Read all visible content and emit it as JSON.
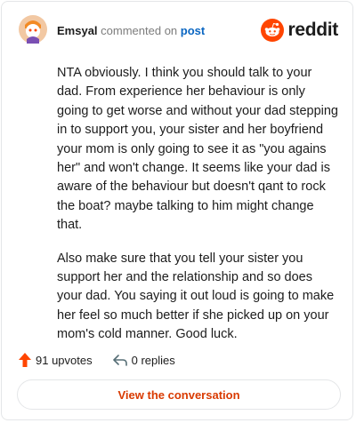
{
  "header": {
    "author": "Emsyal",
    "action_text": "commented on",
    "post_link": "post",
    "brand": "reddit"
  },
  "comment": {
    "paragraphs": [
      "NTA obviously. I think you should talk to your dad. From experience her behaviour is only going to get worse and without your dad stepping in to support you, your sister and her boyfriend your mom is only going to see it as \"you agains her\" and won't change. It seems like your dad is aware of the behaviour but doesn't qant to rock the boat? maybe talking to him might change that.",
      "Also make sure that you tell your sister you support her and the relationship and so does your dad. You saying it out loud is going to make her feel so much better if she picked up on your mom's cold manner. Good luck."
    ]
  },
  "actions": {
    "upvotes": "91 upvotes",
    "replies": "0 replies"
  },
  "cta": {
    "label": "View the conversation"
  },
  "colors": {
    "brand_orange": "#ff4500",
    "cta_text": "#d93a00",
    "link_blue": "#0a66c2"
  }
}
